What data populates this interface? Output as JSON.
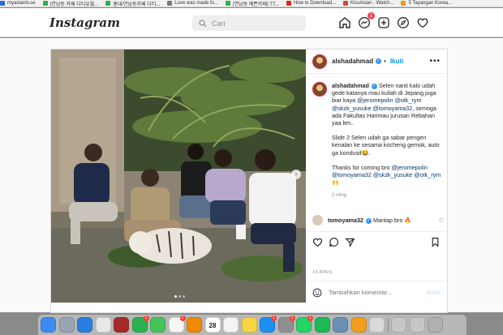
{
  "bookmarks": [
    {
      "label": "myasiantv.se",
      "color": "#2a6ad6"
    },
    {
      "label": "[연남동 카페 디티유월...",
      "color": "#2fb24b"
    },
    {
      "label": "홍대/연남동카페 디티...",
      "color": "#2fb24b"
    },
    {
      "label": "Love was made fo...",
      "color": "#7a7a7a"
    },
    {
      "label": "[연남동 예쁜카페] TT...",
      "color": "#2fb24b"
    },
    {
      "label": "How to Download...",
      "color": "#e02424"
    },
    {
      "label": "KissAsian - Watch...",
      "color": "#d04a2a"
    },
    {
      "label": "5 Tayangan Korea...",
      "color": "#e0a020"
    }
  ],
  "header": {
    "logo": "Instagram",
    "search_placeholder": "Cari",
    "messages_badge": "1"
  },
  "post": {
    "username": "alshadahmad",
    "follow_label": "Ikuti",
    "more_label": "•••",
    "caption_user": "alshadahmad",
    "caption_lines": {
      "p1_a": "Selen nanti kalo udah gede katanya mau kuliah di Jepang juga biar kaya ",
      "tag1": "@jeromepolin",
      "tag2": "@otk_rym",
      "tag3": "@skzk_yusuke",
      "tag4": "@tomoyama32",
      "p1_b": ", semoga ada Fakultas Harimau jurusan Rebahan yaa len..",
      "p2": "Slide 2 Selen udah ga sabar pengen kenalan ke sesama kocheng gemok, auto ga kondusif😂.",
      "p3_a": "Thanks for coming bro ",
      "tag5": "@jeromepolin",
      "tag6": "@tomoyama32",
      "tag7": "@skzk_yusuke",
      "tag8": "@otk_rym",
      "p3_b": " 🙌"
    },
    "caption_time": "2 ming",
    "comment": {
      "user": "tomoyama32",
      "text": "Mantap bro 🔥"
    },
    "date": "14 APRIL",
    "comment_placeholder": "Tambahkan komentar...",
    "post_button": "Kirim"
  },
  "dock": {
    "apps": [
      {
        "name": "finder",
        "color": "#3d8bf2"
      },
      {
        "name": "launchpad",
        "color": "#9aa4b2"
      },
      {
        "name": "safari",
        "color": "#2a7de1"
      },
      {
        "name": "chrome",
        "color": "#e8e8e8"
      },
      {
        "name": "photo-booth",
        "color": "#a62a2a"
      },
      {
        "name": "facetime",
        "color": "#2bb24c",
        "badge": "1"
      },
      {
        "name": "messages",
        "color": "#46c35a"
      },
      {
        "name": "photos",
        "color": "#f5f5f5",
        "badge": "1"
      },
      {
        "name": "vlc",
        "color": "#f08a00"
      },
      {
        "name": "calendar",
        "color": "#ffffff",
        "text": "28"
      },
      {
        "name": "reminders",
        "color": "#f4f4f4"
      },
      {
        "name": "notes",
        "color": "#f7d646"
      },
      {
        "name": "app-store",
        "color": "#1d8ff2",
        "badge": "1"
      },
      {
        "name": "system-preferences",
        "color": "#8e8e93",
        "badge": "1"
      },
      {
        "name": "whatsapp",
        "color": "#25d366",
        "badge": "1"
      },
      {
        "name": "spotify",
        "color": "#1db954"
      },
      {
        "name": "preview",
        "color": "#6a8fb5"
      },
      {
        "name": "pages",
        "color": "#f29e1f"
      },
      {
        "name": "textedit",
        "color": "#d9d9d9"
      },
      {
        "name": "downloads",
        "color": "#c7c7c7"
      },
      {
        "name": "documents",
        "color": "#c7c7c7"
      },
      {
        "name": "trash",
        "color": "#b0b0b0"
      }
    ]
  }
}
